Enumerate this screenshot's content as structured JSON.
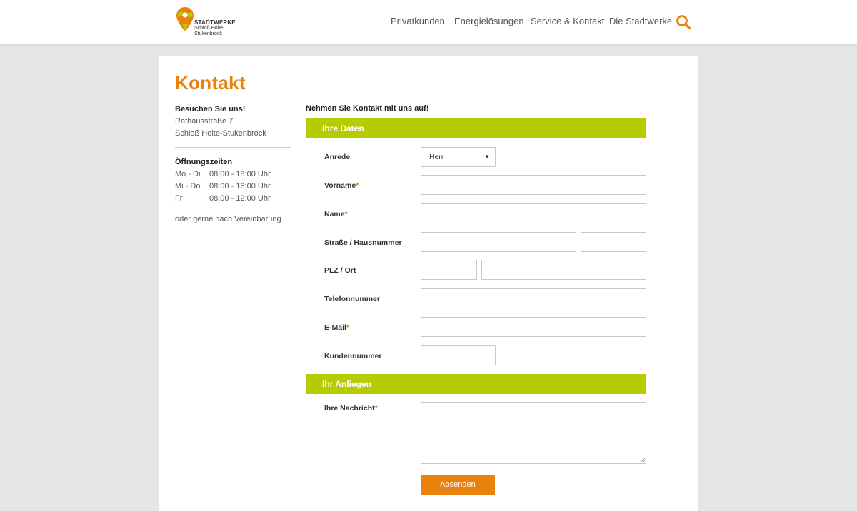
{
  "header": {
    "logo": {
      "line1": "STADTWERKE",
      "line2": "Schloß Holte-",
      "line3": "Stukenbrock"
    },
    "nav": [
      "Privatkunden",
      "Energielösungen",
      "Service & Kontakt",
      "Die Stadtwerke"
    ],
    "search_icon": "search-icon"
  },
  "colors": {
    "accent": "#e8820c",
    "section": "#b6cb00"
  },
  "page": {
    "title": "Kontakt"
  },
  "sidebar": {
    "visit_heading": "Besuchen Sie uns!",
    "street": "Rathausstraße 7",
    "city": "Schloß Holte-Stukenbrock",
    "hours_heading": "Öffnungszeiten",
    "hours": [
      {
        "day": "Mo - Di",
        "time": "08:00 - 18:00 Uhr"
      },
      {
        "day": "Mi - Do",
        "time": "08:00 - 16:00 Uhr"
      },
      {
        "day": "Fr",
        "time": "08:00 - 12:00 Uhr"
      }
    ],
    "note": "oder gerne nach Vereinbarung"
  },
  "form": {
    "intro": "Nehmen Sie Kontakt mit uns auf!",
    "section1": "Ihre Daten",
    "section2": "Ihr Anliegen",
    "labels": {
      "anrede": "Anrede",
      "vorname": "Vorname",
      "name": "Name",
      "strasse": "Straße / Hausnummer",
      "plz": "PLZ / Ort",
      "telefon": "Telefonnummer",
      "email": "E-Mail",
      "kunde": "Kundennummer",
      "nachricht": "Ihre Nachricht"
    },
    "required_mark": "*",
    "anrede_value": "Herr",
    "submit": "Absenden"
  }
}
